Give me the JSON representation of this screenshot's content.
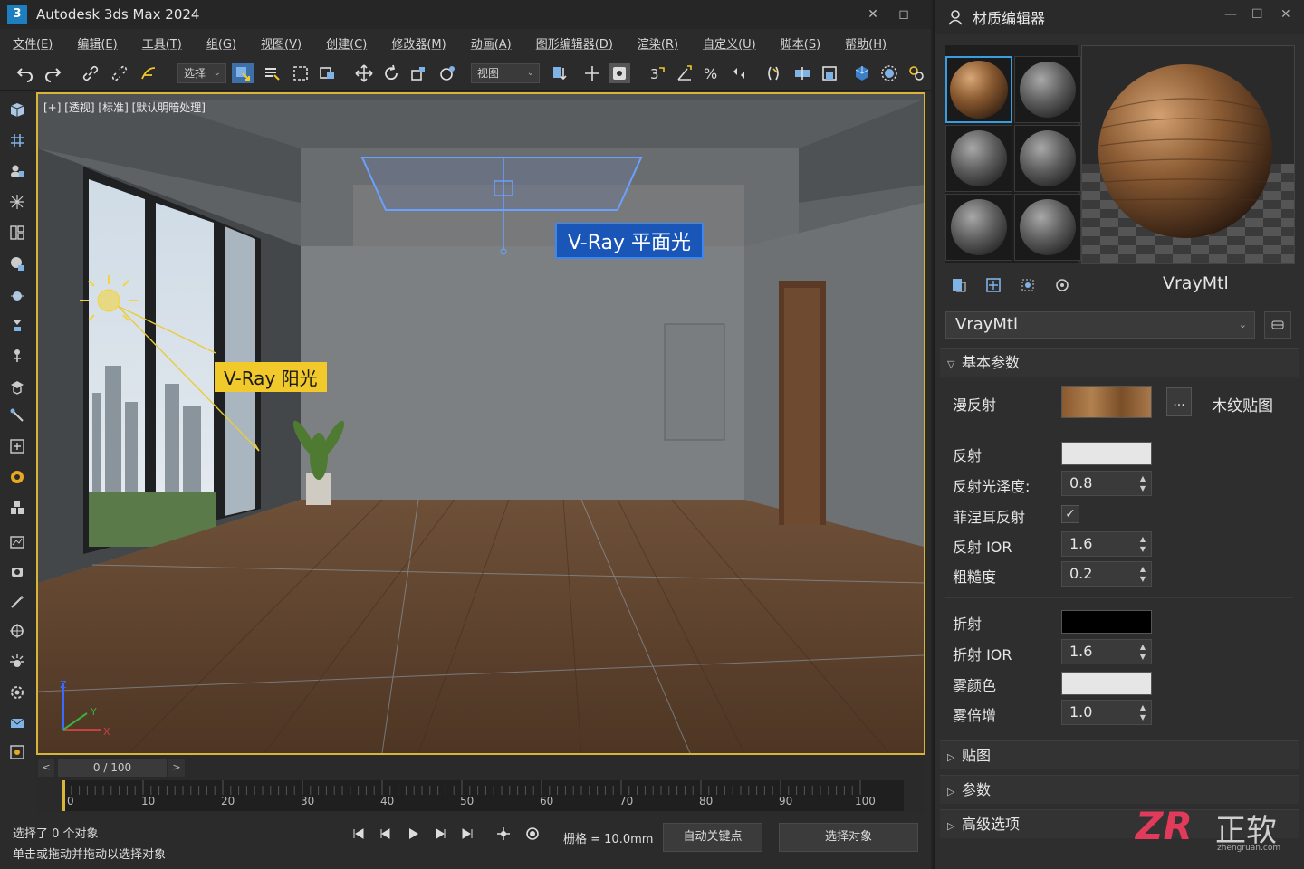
{
  "app": {
    "logo_text": "3",
    "title": "Autodesk 3ds Max 2024"
  },
  "menu": [
    "文件(E)",
    "编辑(E)",
    "工具(T)",
    "组(G)",
    "视图(V)",
    "创建(C)",
    "修改器(M)",
    "动画(A)",
    "图形编辑器(D)",
    "渲染(R)",
    "自定义(U)",
    "脚本(S)",
    "帮助(H)"
  ],
  "toolbar": {
    "selection_filter": "选择",
    "reference_coord": "视图"
  },
  "viewport": {
    "label": "[+] [透视] [标准] [默认明暗处理]",
    "callout_plane_light": "V-Ray 平面光",
    "callout_sun": "V-Ray 阳光",
    "axis_labels": {
      "x": "X",
      "y": "Y",
      "z": "Z"
    }
  },
  "timeline": {
    "frame_display": "0 / 100",
    "prev": "<",
    "next": ">",
    "ticks": [
      "0",
      "10",
      "20",
      "30",
      "40",
      "50",
      "60",
      "70",
      "80",
      "90",
      "100"
    ]
  },
  "status": {
    "line1": "选择了 0 个对象",
    "line2": "单击或拖动并拖动以选择对象",
    "grid": "栅格 = 10.0mm",
    "auto_key": "自动关键点",
    "set_key": "选择对象"
  },
  "material_editor": {
    "title": "材质编辑器",
    "material_name": "VrayMtl",
    "material_type": "VrayMtl",
    "rollout_basic": "基本参数",
    "diffuse": {
      "label": "漫反射",
      "map_button": "...",
      "map_name": "木纹贴图"
    },
    "reflect": {
      "label": "反射",
      "color": "#e6e6e6"
    },
    "reflect_gloss": {
      "label": "反射光泽度:",
      "value": "0.8"
    },
    "fresnel": {
      "label": "菲涅耳反射",
      "checked": "✓"
    },
    "reflect_ior": {
      "label": "反射 IOR",
      "value": "1.6"
    },
    "roughness": {
      "label": "粗糙度",
      "value": "0.2"
    },
    "refract": {
      "label": "折射",
      "color": "#000000"
    },
    "refract_ior": {
      "label": "折射 IOR",
      "value": "1.6"
    },
    "fog_color": {
      "label": "雾颜色",
      "color": "#e6e6e6"
    },
    "fog_mult": {
      "label": "雾倍增",
      "value": "1.0"
    },
    "rollout_maps": "贴图",
    "rollout_params": "参数",
    "rollout_advanced": "高级选项"
  },
  "watermark": {
    "mark": "ZR",
    "brand": "正软",
    "url": "zhengruan.com"
  },
  "colors": {
    "accent": "#1d7fbf",
    "viewport_border": "#d9b43a",
    "callout_blue": "#1a55b8",
    "callout_yellow": "#f2c92a",
    "brand_red": "#e23a5a"
  }
}
